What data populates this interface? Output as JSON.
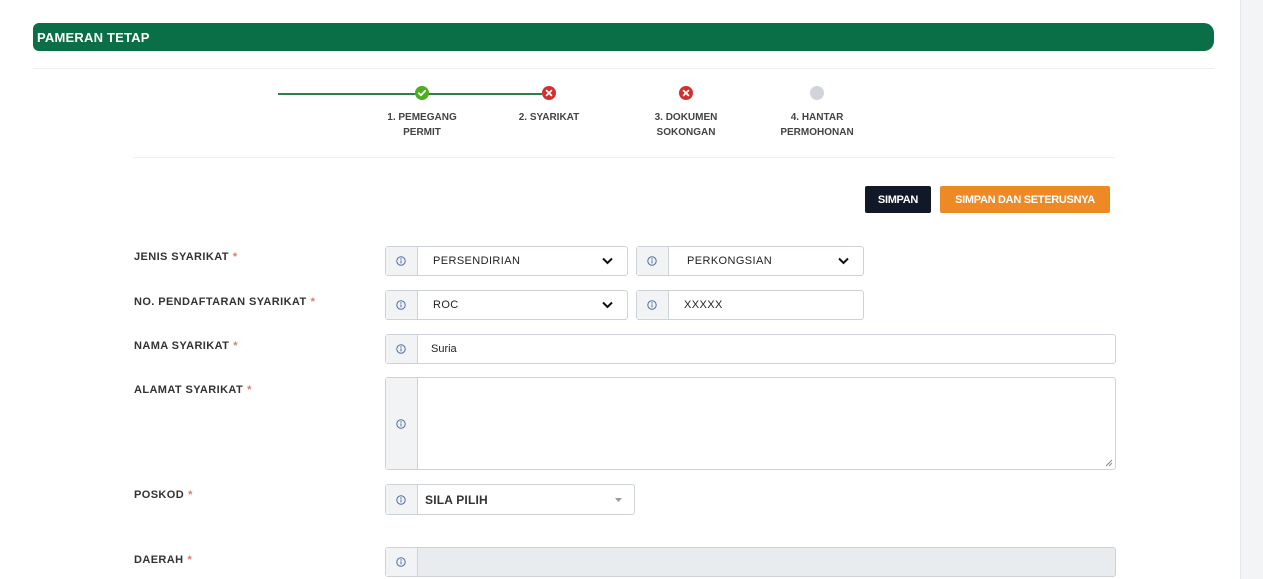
{
  "header": {
    "title": "PAMERAN TETAP"
  },
  "steps": [
    {
      "line1": "1. PEMEGANG",
      "line2": "PERMIT",
      "status": "complete"
    },
    {
      "line1": "2. SYARIKAT",
      "line2": "",
      "status": "error"
    },
    {
      "line1": "3. DOKUMEN",
      "line2": "SOKONGAN",
      "status": "error"
    },
    {
      "line1": "4. HANTAR",
      "line2": "PERMOHONAN",
      "status": "pending"
    }
  ],
  "actions": {
    "save_label": "SIMPAN",
    "save_next_label": "SIMPAN DAN SETERUSNYA"
  },
  "form": {
    "jenis_syarikat": {
      "label": "JENIS SYARIKAT",
      "value1": "PERSENDIRIAN",
      "value2": "PERKONGSIAN"
    },
    "no_pendaftaran": {
      "label": "NO. PENDAFTARAN SYARIKAT",
      "type_value": "ROC",
      "number_value": "XXXXX"
    },
    "nama_syarikat": {
      "label": "NAMA SYARIKAT",
      "value": "Suria"
    },
    "alamat_syarikat": {
      "label": "ALAMAT SYARIKAT",
      "value": ""
    },
    "poskod": {
      "label": "POSKOD",
      "value": "SILA PILIH"
    },
    "daerah": {
      "label": "DAERAH",
      "value": ""
    },
    "required_marker": "*"
  },
  "colors": {
    "brand": "#0a6e46",
    "complete": "#4caf1f",
    "error": "#d32f2f",
    "pending": "#d1d5db",
    "accent": "#ee8a26"
  }
}
